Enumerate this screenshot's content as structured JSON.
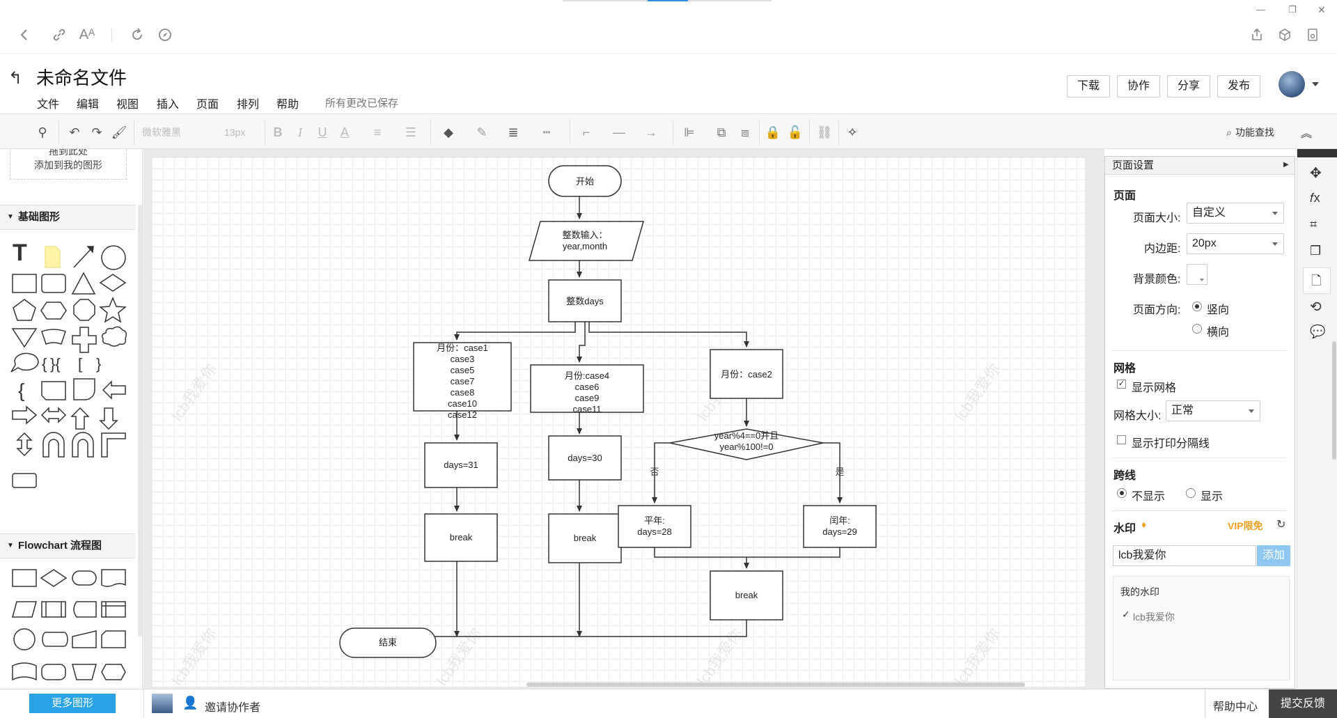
{
  "browser": {
    "icons": [
      "back-icon",
      "link-icon",
      "font-size-icon",
      "reload-icon",
      "compass-icon",
      "share-icon",
      "cube-icon",
      "screenshot-icon"
    ],
    "window_controls": [
      "—",
      "❐",
      "✕"
    ]
  },
  "header": {
    "title": "未命名文件",
    "menus": [
      "文件",
      "编辑",
      "视图",
      "插入",
      "页面",
      "排列",
      "帮助"
    ],
    "save_status": "所有更改已保存",
    "buttons": [
      "下载",
      "协作",
      "分享",
      "发布"
    ]
  },
  "toolbar": {
    "font_family": "微软雅黑",
    "font_size": "13px",
    "bold": "B",
    "italic": "I",
    "underline": "U",
    "font_color": "A",
    "feature_search": "功能查找"
  },
  "left_panel": {
    "drop_hint_line1": "拖到此处",
    "drop_hint_line2": "添加到我的图形",
    "section_basic": "基础图形",
    "section_flowchart": "Flowchart 流程图",
    "more_shapes_button": "更多图形"
  },
  "diagram": {
    "start": "开始",
    "input_line1": "整数输入：",
    "input_line2": "year,month",
    "days": "整数days",
    "box1_lines": [
      "月份：case1",
      "case3",
      "case5",
      "case7",
      "case8",
      "case10",
      "case12"
    ],
    "box2_lines": [
      "月份:case4",
      "case6",
      "case9",
      "case11"
    ],
    "box3": "月份：case2",
    "days31": "days=31",
    "days30": "days=30",
    "break": "break",
    "diamond_line1": "year%4==0并且",
    "diamond_line2": "year%100!=0",
    "no": "否",
    "yes": "是",
    "common_line1": "平年:",
    "common_line2": "days=28",
    "leap_line1": "闰年:",
    "leap_line2": "days=29",
    "end": "结束",
    "watermark": "lcb我爱你"
  },
  "right_panel": {
    "title": "页面设置",
    "section_page": "页面",
    "page_size_label": "页面大小:",
    "page_size_value": "自定义",
    "padding_label": "内边距:",
    "padding_value": "20px",
    "bg_color_label": "背景颜色:",
    "orientation_label": "页面方向:",
    "portrait": "竖向",
    "landscape": "横向",
    "section_grid": "网格",
    "show_grid": "显示网格",
    "grid_size_label": "网格大小:",
    "grid_size_value": "正常",
    "show_print_lines": "显示打印分隔线",
    "section_jump": "跨线",
    "hide": "不显示",
    "show": "显示",
    "section_watermark": "水印",
    "vip": "VIP限免",
    "watermark_input": "lcb我爱你",
    "add_button": "添加",
    "my_watermark": "我的水印",
    "my_watermark_item": "lcb我爱你"
  },
  "bottom_bar": {
    "invite": "邀请协作者",
    "help_center": "帮助中心",
    "feedback": "提交反馈"
  }
}
